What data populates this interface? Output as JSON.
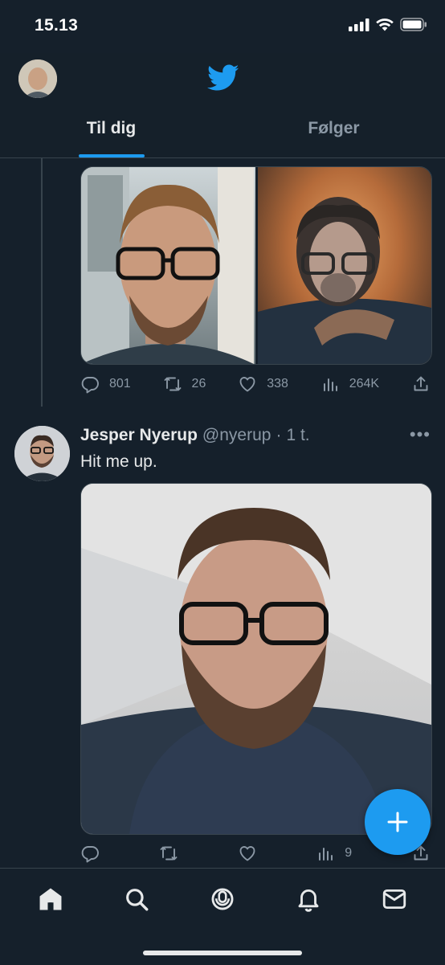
{
  "status_bar": {
    "time": "15.13"
  },
  "header": {
    "tabs": [
      {
        "label": "Til dig",
        "active": true
      },
      {
        "label": "Følger",
        "active": false
      }
    ]
  },
  "tweet1": {
    "stats": {
      "replies": "801",
      "retweets": "26",
      "likes": "338",
      "views": "264K"
    }
  },
  "tweet2": {
    "name": "Jesper Nyerup",
    "handle": "@nyerup",
    "dot": "·",
    "time": "1 t.",
    "text": "Hit me up.",
    "stats": {
      "views": "9"
    }
  },
  "icons": {
    "reply": "reply-icon",
    "retweet": "retweet-icon",
    "like": "heart-icon",
    "views": "views-icon",
    "share": "share-icon",
    "compose": "plus-icon",
    "nav": [
      "home-icon",
      "search-icon",
      "spaces-icon",
      "bell-icon",
      "mail-icon"
    ]
  },
  "colors": {
    "accent": "#1d9bf0",
    "background": "#15202b",
    "muted": "#8b98a5",
    "text": "#e7e9ea"
  }
}
